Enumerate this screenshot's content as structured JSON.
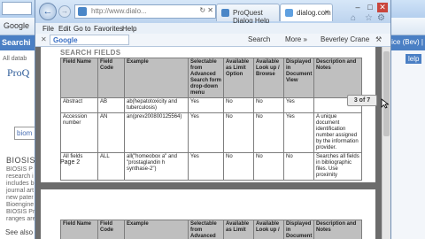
{
  "background": {
    "tab_left_label": "Searchi",
    "tab_right_label": "ice (Bev) | ",
    "right_badge": "lelp",
    "google_label": "Google",
    "all_databases": "All datab",
    "proquest_logo": "ProQ",
    "search_value": "biom",
    "biosis_heading": "BIOSIS",
    "biosis_lines": [
      "BIOSIS P",
      "research i",
      "includes b",
      "journal art",
      "new pater",
      "Bioengine",
      "BIOSIS Pr",
      "ranges are"
    ],
    "footer_text": "See also"
  },
  "popup": {
    "url": "http://www.dialo...",
    "tabs": [
      {
        "label": "ProQuest Dialog Help"
      },
      {
        "label": "dialog.com"
      }
    ],
    "menu": [
      "File",
      "Edit",
      "Go to",
      "Favorites",
      "Help"
    ],
    "toolbar": {
      "google": "Google",
      "search": "Search",
      "more": "More »",
      "user": "Beverley Crane"
    },
    "document": {
      "section_title": "SEARCH FIELDS",
      "pager": "3 of 7",
      "page_number": "Page 2",
      "columns": [
        "Field Name",
        "Field Code",
        "Example",
        "Selectable from Advanced Search form drop-down menu",
        "Available as Limit Option",
        "Available Look up / Browse",
        "Displayed in Document View",
        "Description and Notes"
      ],
      "rows": [
        [
          "Abstract",
          "AB",
          "ab(hepatotoxicity and tuberculosis)",
          "Yes",
          "No",
          "No",
          "Yes",
          ""
        ],
        [
          "Accession number",
          "AN",
          "an(prev200800125564)",
          "Yes",
          "No",
          "No",
          "Yes",
          "A unique document identification number assigned by the information provider."
        ],
        [
          "All fields",
          "ALL",
          "all(\"homeobox a\" and \"prostaglandin h synthase-2\")",
          "Yes",
          "No",
          "No",
          "No",
          "Searches all fields in bibliographic files. Use proximity"
        ]
      ],
      "columns_page2": [
        "Field Name",
        "Field Code",
        "Example",
        "Selectable from Advanced Search",
        "Available as Limit",
        "Available Look up /",
        "Displayed in Document",
        "Description and Notes"
      ]
    }
  }
}
